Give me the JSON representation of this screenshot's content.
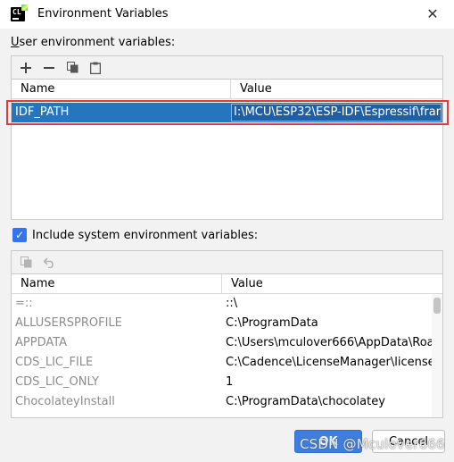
{
  "window": {
    "title": "Environment Variables",
    "close_glyph": "✕"
  },
  "user_section": {
    "label_prefix": "U",
    "label_rest": "ser environment variables:",
    "columns": {
      "name": "Name",
      "value": "Value"
    },
    "rows": [
      {
        "name": "IDF_PATH",
        "value": "I:\\MCU\\ESP32\\ESP-IDF\\Espressif\\fram..."
      }
    ]
  },
  "include_system": {
    "checked": true,
    "check_glyph": "✓",
    "label": "Include system environment variables:"
  },
  "system_section": {
    "columns": {
      "name": "Name",
      "value": "Value"
    },
    "rows": [
      {
        "name": "=::",
        "value": "::\\"
      },
      {
        "name": "ALLUSERSPROFILE",
        "value": "C:\\ProgramData"
      },
      {
        "name": "APPDATA",
        "value": "C:\\Users\\mculover666\\AppData\\Roa..."
      },
      {
        "name": "CDS_LIC_FILE",
        "value": "C:\\Cadence\\LicenseManager\\license...."
      },
      {
        "name": "CDS_LIC_ONLY",
        "value": "1"
      },
      {
        "name": "ChocolateyInstall",
        "value": "C:\\ProgramData\\chocolatey"
      }
    ]
  },
  "buttons": {
    "ok": "OK",
    "cancel": "Cancel"
  },
  "watermark": "CSDN @Mculover666",
  "colors": {
    "accent": "#3574f0",
    "selection": "#2675bf",
    "highlight_frame": "#e33a3a"
  }
}
